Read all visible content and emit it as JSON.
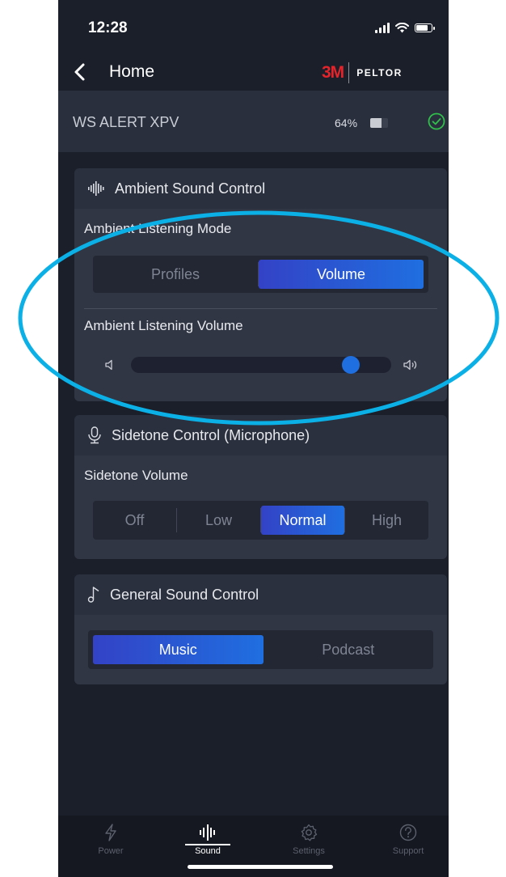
{
  "status_bar": {
    "time": "12:28"
  },
  "nav": {
    "back_label": "Home",
    "brand_mark": "3M",
    "brand_name": "PELTOR"
  },
  "device": {
    "name": "WS ALERT XPV",
    "battery_percent": "64%",
    "connected": true
  },
  "ambient": {
    "title": "Ambient Sound Control",
    "mode_label": "Ambient Listening Mode",
    "mode_options": [
      "Profiles",
      "Volume"
    ],
    "mode_selected": "Volume",
    "volume_label": "Ambient Listening Volume",
    "volume_level": 0.87
  },
  "sidetone": {
    "title": "Sidetone Control (Microphone)",
    "volume_label": "Sidetone Volume",
    "options": [
      "Off",
      "Low",
      "Normal",
      "High"
    ],
    "selected": "Normal"
  },
  "general": {
    "title": "General Sound Control",
    "options": [
      "Music",
      "Podcast"
    ],
    "selected": "Music"
  },
  "tabbar": {
    "tabs": [
      {
        "label": "Power",
        "icon": "bolt-icon",
        "active": false
      },
      {
        "label": "Sound",
        "icon": "soundwave-icon",
        "active": true
      },
      {
        "label": "Settings",
        "icon": "gear-icon",
        "active": false
      },
      {
        "label": "Support",
        "icon": "help-icon",
        "active": false
      }
    ]
  },
  "colors": {
    "accent": "#1f6fe0",
    "highlight_ring": "#0ab0e6",
    "brand_red": "#e4242b",
    "connected_green": "#2fbf4a"
  }
}
